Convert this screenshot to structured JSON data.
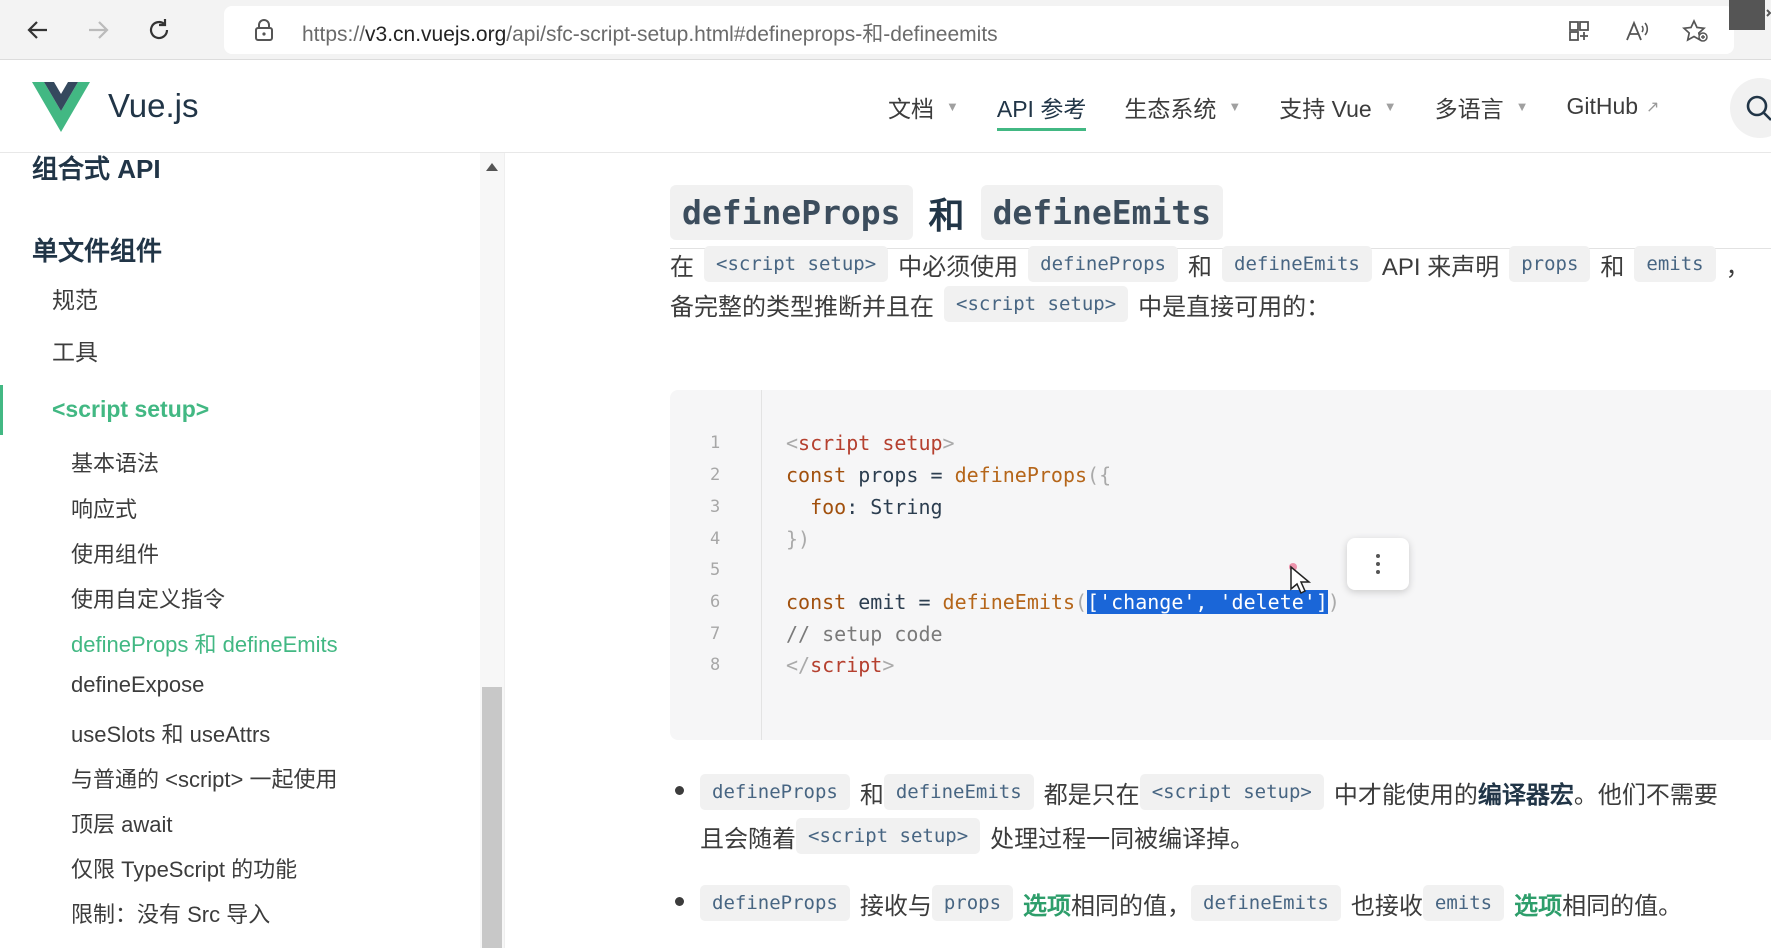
{
  "browser": {
    "url_prefix": "https://",
    "url_host": "v3.cn.vuejs.org",
    "url_path": "/api/sfc-script-setup.html#defineprops-和-defineemits"
  },
  "header": {
    "brand": "Vue.js",
    "nav": [
      {
        "label": "文档",
        "dropdown": true
      },
      {
        "label": "API 参考",
        "active": true
      },
      {
        "label": "生态系统",
        "dropdown": true
      },
      {
        "label": "支持 Vue",
        "dropdown": true
      },
      {
        "label": "多语言",
        "dropdown": true
      },
      {
        "label": "GitHub",
        "external": true
      }
    ]
  },
  "sidebar": {
    "group_partial": "组合式 API",
    "group": "单文件组件",
    "items": [
      "规范",
      "工具",
      "<script setup>"
    ],
    "subitems": [
      "基本语法",
      "响应式",
      "使用组件",
      "使用自定义指令",
      "defineProps 和 defineEmits",
      "defineExpose",
      "useSlots 和 useAttrs",
      "与普通的 <script> 一起使用",
      "顶层 await",
      "仅限 TypeScript 的功能",
      "限制：没有 Src 导入",
      "..."
    ]
  },
  "main": {
    "heading": {
      "code1": "defineProps",
      "and": "和",
      "code2": "defineEmits"
    },
    "para1": {
      "t1": "在",
      "c1": "<script setup>",
      "t2": "中必须使用",
      "c2": "defineProps",
      "t3": "和",
      "c3": "defineEmits",
      "t4": "API 来声明",
      "c4": "props",
      "t5": "和",
      "c5": "emits",
      "t6": "，"
    },
    "para2": {
      "t1": "备完整的类型推断并且在",
      "c1": "<script setup>",
      "t2": "中是直接可用的："
    },
    "code_lines": [
      "1",
      "2",
      "3",
      "4",
      "5",
      "6",
      "7",
      "8"
    ],
    "code": {
      "l1_tag_open": "<",
      "l1_name": "script setup",
      "l1_tag_close": ">",
      "l2_kw": "const",
      "l2_var": " props = ",
      "l2_fn": "defineProps",
      "l2_punc": "({",
      "l3_prop": "  foo",
      "l3_rest": ": String",
      "l4": "})",
      "l6_kw": "const",
      "l6_var": " emit = ",
      "l6_fn": "defineEmits",
      "l6_po": "(",
      "l6_sel": "['change', 'delete']",
      "l6_pc": ")",
      "l7": "// setup code",
      "l8_open": "</",
      "l8_name": "script",
      "l8_close": ">"
    },
    "bullet1": {
      "c1": "defineProps",
      "t1": "和",
      "c2": "defineEmits",
      "t2": "都是只在",
      "c3": "<script setup>",
      "t3": "中才能使用的",
      "strong": "编译器宏",
      "t4": "。他们不需要",
      "line2_t1": "且会随着",
      "line2_c1": "<script setup>",
      "line2_t2": "处理过程一同被编译掉。"
    },
    "bullet2": {
      "c1": "defineProps",
      "t1": "接收与",
      "c2": "props",
      "link1": "选项",
      "t2": "相同的值，",
      "c3": "defineEmits",
      "t3": "也接收",
      "c4": "emits",
      "link2": "选项",
      "t4": "相同的值。"
    }
  }
}
